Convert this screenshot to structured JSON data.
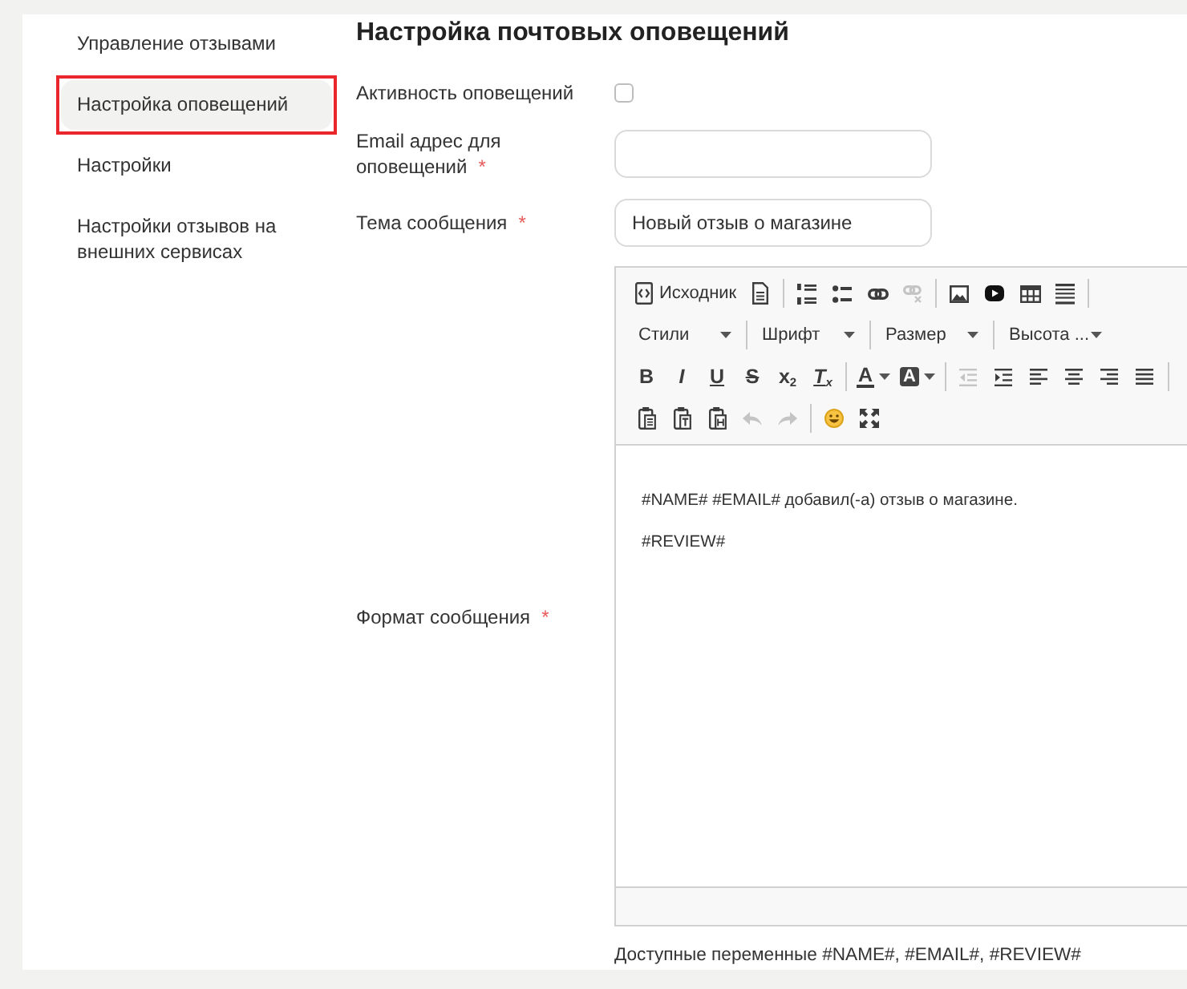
{
  "sidebar": {
    "items": [
      {
        "label": "Управление отзывами",
        "selected": false,
        "highlighted": false
      },
      {
        "label": "Настройка оповещений",
        "selected": true,
        "highlighted": true
      },
      {
        "label": "Настройки",
        "selected": false,
        "highlighted": false
      },
      {
        "label": "Настройки отзывов на внешних сервисах",
        "selected": false,
        "highlighted": false
      }
    ]
  },
  "form": {
    "title": "Настройка почтовых оповещений",
    "fields": [
      {
        "kind": "checkbox",
        "label": "Активность оповещений",
        "checked": false
      },
      {
        "kind": "text",
        "label": "Email адрес для оповещений",
        "mark": "*"
      },
      {
        "kind": "text",
        "label": "Тема сообщения",
        "mark": "*",
        "value": "Новый отзыв о магазине"
      },
      {
        "kind": "editor",
        "label": "Формат сообщения",
        "mark": "*",
        "toolbar": {
          "rows": [
            {
              "items": [
                {
                  "kind": "source",
                  "label": "Исходник",
                  "disabled": false
                },
                {
                  "kind": "document",
                  "disabled": false
                },
                {
                  "kind": "separator"
                },
                {
                  "kind": "numbered-list",
                  "disabled": false
                },
                {
                  "kind": "bullet-list",
                  "disabled": false
                },
                {
                  "kind": "link",
                  "disabled": false
                },
                {
                  "kind": "unlink",
                  "disabled": true
                },
                {
                  "kind": "separator"
                },
                {
                  "kind": "image",
                  "disabled": false
                },
                {
                  "kind": "video",
                  "disabled": false
                },
                {
                  "kind": "table",
                  "disabled": false
                },
                {
                  "kind": "lines",
                  "disabled": false
                },
                {
                  "kind": "separator"
                }
              ]
            },
            {
              "items": [
                {
                  "kind": "dropdown",
                  "label": "Стили",
                  "disabled": false
                },
                {
                  "kind": "separator"
                },
                {
                  "kind": "dropdown",
                  "label": "Шрифт",
                  "disabled": false
                },
                {
                  "kind": "separator"
                },
                {
                  "kind": "dropdown",
                  "label": "Размер",
                  "disabled": false
                },
                {
                  "kind": "separator"
                },
                {
                  "kind": "dropdown",
                  "label": "Высота ...",
                  "disabled": false
                }
              ]
            },
            {
              "items": [
                {
                  "kind": "bold",
                  "label": "B",
                  "disabled": false
                },
                {
                  "kind": "italic",
                  "label": "I",
                  "disabled": false
                },
                {
                  "kind": "underline",
                  "label": "U",
                  "disabled": false
                },
                {
                  "kind": "strike",
                  "label": "S",
                  "disabled": false
                },
                {
                  "kind": "subscript",
                  "label": "x$_{2}$",
                  "disabled": false
                },
                {
                  "kind": "remove-format",
                  "label": "T$_{x}$",
                  "disabled": false
                },
                {
                  "kind": "separator"
                },
                {
                  "kind": "text-color",
                  "label": "A",
                  "disabled": false
                },
                {
                  "kind": "bg-color",
                  "label": "A",
                  "disabled": false
                },
                {
                  "kind": "separator"
                },
                {
                  "kind": "outdent",
                  "disabled": true
                },
                {
                  "kind": "indent",
                  "disabled": false
                },
                {
                  "kind": "align-left",
                  "disabled": false
                },
                {
                  "kind": "align-center",
                  "disabled": false
                },
                {
                  "kind": "align-right",
                  "disabled": false
                },
                {
                  "kind": "justify",
                  "disabled": false
                },
                {
                  "kind": "separator"
                }
              ]
            },
            {
              "items": [
                {
                  "kind": "paste",
                  "disabled": false
                },
                {
                  "kind": "paste-text",
                  "disabled": false
                },
                {
                  "kind": "paste-word",
                  "disabled": false
                },
                {
                  "kind": "undo",
                  "disabled": true
                },
                {
                  "kind": "redo",
                  "disabled": true
                },
                {
                  "kind": "separator"
                },
                {
                  "kind": "emoji",
                  "disabled": false
                },
                {
                  "kind": "maximize",
                  "disabled": false
                }
              ]
            }
          ]
        },
        "content": [
          "#NAME# #EMAIL# добавил(-а) отзыв о магазине.",
          "#REVIEW#"
        ],
        "help_text": "Доступные переменные #NAME#, #EMAIL#, #REVIEW#"
      }
    ]
  }
}
